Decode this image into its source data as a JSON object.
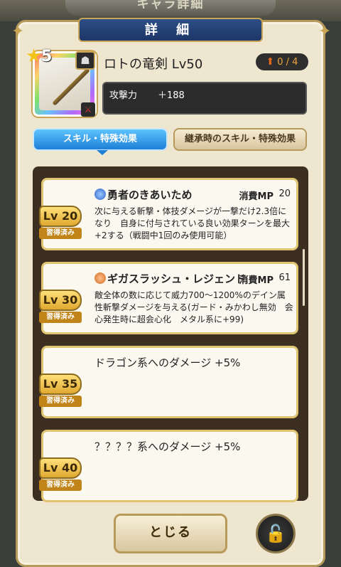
{
  "window_title": "キャラ詳細",
  "header": {
    "title": "詳 細"
  },
  "item": {
    "rarity_stars": "5",
    "name": "ロトの竜剣 Lv50",
    "upgrade_count": "0 / 4",
    "stats": [
      {
        "label": "攻撃力",
        "value": "＋188"
      }
    ],
    "icon_name": "sword-icon"
  },
  "tabs": [
    {
      "label": "スキル・特殊効果",
      "active": true
    },
    {
      "label": "継承時のスキル・特殊効果",
      "active": false
    }
  ],
  "skills": [
    {
      "level": "Lv 20",
      "learned": "習得済み",
      "icon": "blue",
      "name": "勇者のきあいため",
      "mp_label": "消費MP",
      "mp_value": "20",
      "description": "次に与える斬撃・体技ダメージが一撃だけ2.3倍になり　自身に付与されている良い効果ターンを最大+2する（戦闘中1回のみ使用可能）"
    },
    {
      "level": "Lv 30",
      "learned": "習得済み",
      "icon": "orange",
      "name": "ギガスラッシュ・レジェンド",
      "mp_label": "消費MP",
      "mp_value": "61",
      "description": "敵全体の数に応じて威力700～1200%のデイン属性斬撃ダメージを与える(ガード・みかわし無効　会心発生時に超会心化　メタル系に+99)"
    },
    {
      "level": "Lv 35",
      "learned": "習得済み",
      "name": "ドラゴン系へのダメージ +5%"
    },
    {
      "level": "Lv 40",
      "learned": "習得済み",
      "name": "？？？？系へのダメージ +5%"
    }
  ],
  "buttons": {
    "close_label": "とじる"
  },
  "colors": {
    "accent_blue": "#1d7fd6",
    "gold": "#c9a456",
    "panel": "#efe6cf"
  }
}
